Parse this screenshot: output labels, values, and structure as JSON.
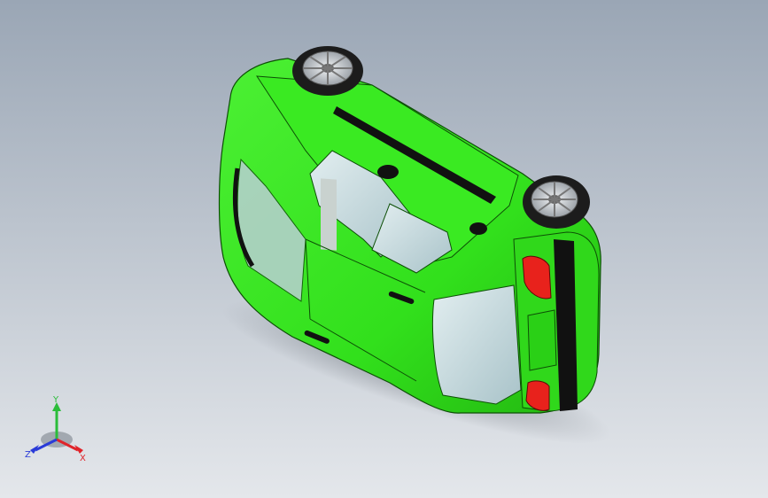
{
  "viewport": {
    "background_top": "#9aa6b5",
    "background_bottom": "#e4e7eb"
  },
  "model": {
    "body_color": "#32e01c",
    "body_shade": "#24b812",
    "glass_color": "#bfd6dc",
    "stripe_color": "#111111",
    "taillight_color": "#e8221c",
    "tire_color": "#1c1c1c",
    "rim_color": "#c8ccd0"
  },
  "triad": {
    "x_label": "X",
    "y_label": "Y",
    "z_label": "Z",
    "x_color": "#e0242a",
    "y_color": "#2bbd3a",
    "z_color": "#2a3bd8"
  }
}
